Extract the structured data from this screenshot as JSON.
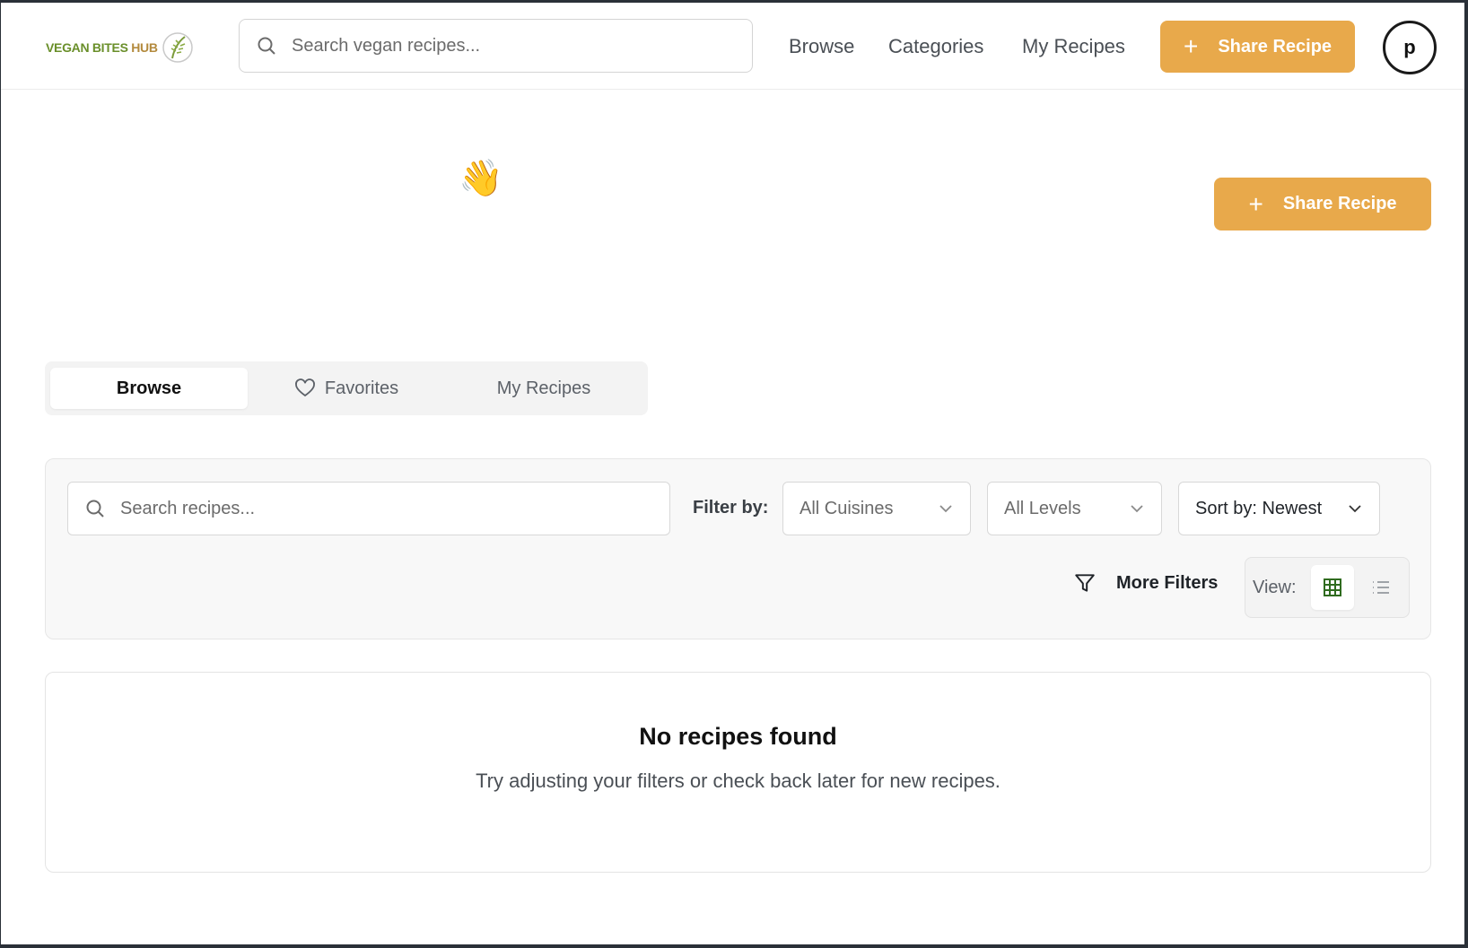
{
  "header": {
    "logo_main": "VEGAN BITES",
    "logo_hub": "HUB",
    "search_placeholder": "Search vegan recipes...",
    "nav": [
      "Browse",
      "Categories",
      "My Recipes"
    ],
    "share_label": "Share Recipe",
    "avatar_initial": "p"
  },
  "hero": {
    "wave_emoji": "👋",
    "share_label": "Share Recipe"
  },
  "tabs": [
    {
      "label": "Browse",
      "active": true
    },
    {
      "label": "Favorites",
      "active": false
    },
    {
      "label": "My Recipes",
      "active": false
    }
  ],
  "filters": {
    "search_placeholder": "Search recipes...",
    "filter_by_label": "Filter by:",
    "cuisine_value": "All Cuisines",
    "level_value": "All Levels",
    "sort_value": "Sort by: Newest",
    "more_filters_label": "More Filters",
    "view_label": "View:",
    "view_mode": "grid"
  },
  "empty_state": {
    "title": "No recipes found",
    "message": "Try adjusting your filters or check back later for new recipes."
  },
  "colors": {
    "accent": "#e8a94b",
    "logo_green": "#6a8f2a",
    "grid_icon_green": "#2f6b1f"
  },
  "icons": [
    "search-icon",
    "plus-icon",
    "waving-hand-emoji",
    "heart-icon",
    "chevron-down-icon",
    "filter-icon",
    "grid-view-icon",
    "list-view-icon",
    "leaf-logo-icon"
  ]
}
